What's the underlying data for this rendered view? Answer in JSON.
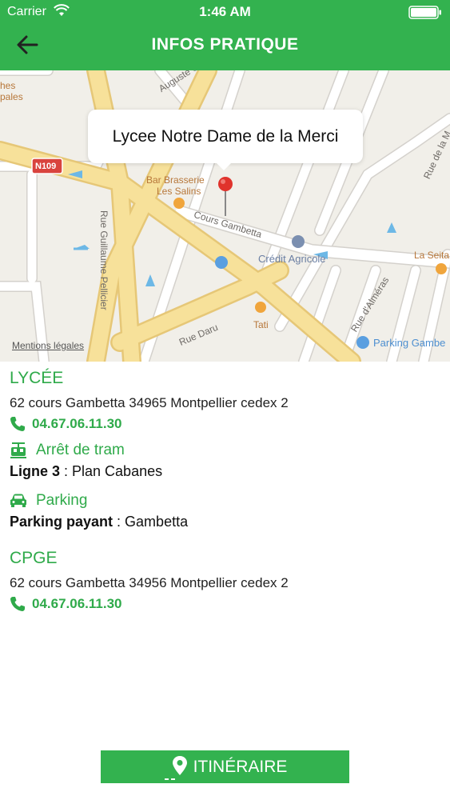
{
  "status": {
    "carrier": "Carrier",
    "time": "1:46 AM"
  },
  "header": {
    "title": "INFOS PRATIQUE"
  },
  "map": {
    "callout": "Lycee Notre Dame de la Merci",
    "legal": "Mentions légales",
    "labels": {
      "auguste": "Auguste Com",
      "road_n109": "N109",
      "bar": "Bar Brasserie",
      "bar2": "Les Salins",
      "cours_gambetta": "Cours Gambetta",
      "credit": "Crédit Agricole",
      "guillaume": "Rue Guillaume Pellicier",
      "daru": "Rue Daru",
      "tati": "Tati",
      "almeras": "Rue d'Alméras",
      "parking": "Parking Gambe",
      "laseita": "La Seita",
      "ruedela": "Rue de la M",
      "hes": "hes",
      "pales": "pales"
    }
  },
  "lycee": {
    "title": "LYCÉE",
    "address": "62 cours Gambetta 34965 Montpellier cedex 2",
    "phone": "04.67.06.11.30",
    "tram_label": "Arrêt de tram",
    "tram_line_bold": "Ligne 3",
    "tram_line_rest": " : Plan Cabanes",
    "parking_label": "Parking",
    "parking_bold": "Parking payant",
    "parking_rest": " : Gambetta"
  },
  "cpge": {
    "title": "CPGE",
    "address": "62 cours Gambetta 34956 Montpellier cedex 2",
    "phone": "04.67.06.11.30"
  },
  "button": {
    "label": "ITINÉRAIRE"
  },
  "colors": {
    "brand": "#33b24f",
    "accent_text": "#2faa4a"
  }
}
